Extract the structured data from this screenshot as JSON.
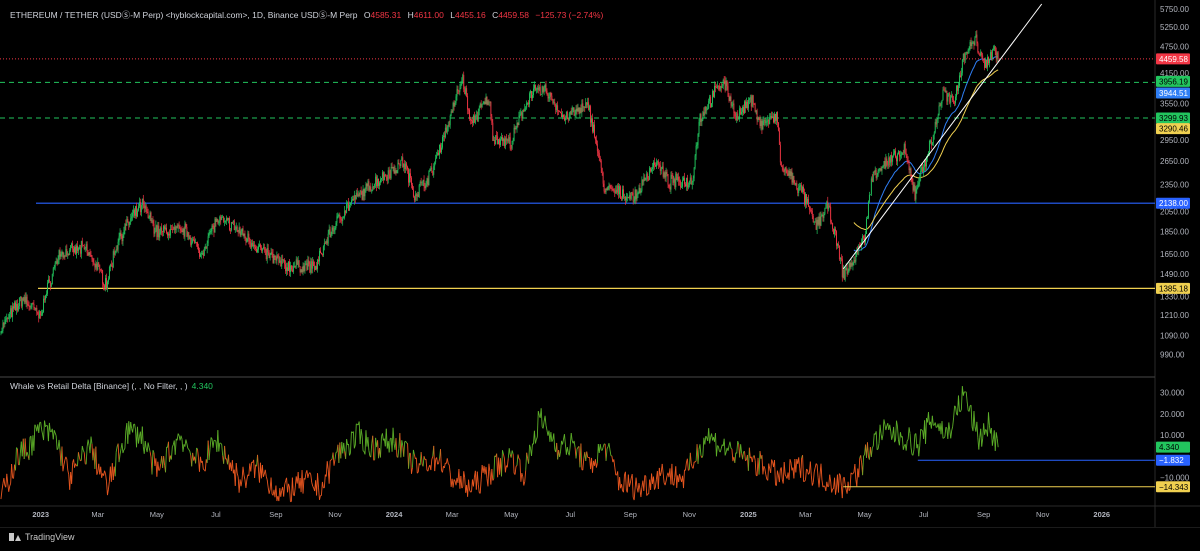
{
  "header": {
    "symbol": "ETHEREUM / TETHER (USDⓈ-M Perp) <hyblockcapital.com>, 1D, Binance USDⓈ-M Perp",
    "o_label": "O",
    "o_value": "4585.31",
    "h_label": "H",
    "h_value": "4611.00",
    "l_label": "L",
    "l_value": "4455.16",
    "c_label": "C",
    "c_value": "4459.58",
    "change": "−125.73 (−2.74%)"
  },
  "indicator": {
    "title": "Whale vs Retail Delta [Binance] (, , No Filter, , )",
    "value": "4.340"
  },
  "footer": {
    "brand": "TradingView"
  },
  "colors": {
    "background": "#000000",
    "up": "#22c55e",
    "down": "#f23645",
    "blue_level": "#2962ff",
    "yellow_level": "#f0d050",
    "green_dash": "#22c55e",
    "red_dotted": "#f23645",
    "trendline": "#ffffff",
    "ema_blue": "#2f7ff6",
    "ema_yellow": "#f0d050",
    "delta_pos": "#5cae28",
    "delta_neg": "#e8561f"
  },
  "chart_data": [
    {
      "type": "candlestick",
      "scale": "log",
      "ylim": [
        900,
        5900
      ],
      "xlim": [
        "2022-11-20",
        "2026-02-25"
      ],
      "price_ticks": [
        5750,
        5250,
        4750,
        4150,
        3950,
        3550,
        3250,
        2950,
        2650,
        2350,
        2050,
        1850,
        1650,
        1490,
        1330,
        1210,
        1090,
        990
      ],
      "time_labels": [
        {
          "date": "2023-01-01",
          "label": "2023"
        },
        {
          "date": "2023-03-01",
          "label": "Mar"
        },
        {
          "date": "2023-05-01",
          "label": "May"
        },
        {
          "date": "2023-07-01",
          "label": "Jul"
        },
        {
          "date": "2023-09-01",
          "label": "Sep"
        },
        {
          "date": "2023-11-01",
          "label": "Nov"
        },
        {
          "date": "2024-01-01",
          "label": "2024"
        },
        {
          "date": "2024-03-01",
          "label": "Mar"
        },
        {
          "date": "2024-05-01",
          "label": "May"
        },
        {
          "date": "2024-07-01",
          "label": "Jul"
        },
        {
          "date": "2024-09-01",
          "label": "Sep"
        },
        {
          "date": "2024-11-01",
          "label": "Nov"
        },
        {
          "date": "2025-01-01",
          "label": "2025"
        },
        {
          "date": "2025-03-01",
          "label": "Mar"
        },
        {
          "date": "2025-05-01",
          "label": "May"
        },
        {
          "date": "2025-07-01",
          "label": "Jul"
        },
        {
          "date": "2025-09-01",
          "label": "Sep"
        },
        {
          "date": "2025-11-01",
          "label": "Nov"
        },
        {
          "date": "2026-01-01",
          "label": "2026"
        }
      ],
      "close_anchors": [
        [
          "2022-11-21",
          1130
        ],
        [
          "2022-12-14",
          1320
        ],
        [
          "2022-12-31",
          1200
        ],
        [
          "2023-01-20",
          1650
        ],
        [
          "2023-02-16",
          1700
        ],
        [
          "2023-03-10",
          1420
        ],
        [
          "2023-03-23",
          1800
        ],
        [
          "2023-04-16",
          2120
        ],
        [
          "2023-05-01",
          1850
        ],
        [
          "2023-06-01",
          1860
        ],
        [
          "2023-06-15",
          1640
        ],
        [
          "2023-07-01",
          1950
        ],
        [
          "2023-07-15",
          1930
        ],
        [
          "2023-08-17",
          1680
        ],
        [
          "2023-09-11",
          1550
        ],
        [
          "2023-10-13",
          1550
        ],
        [
          "2023-10-24",
          1790
        ],
        [
          "2023-11-12",
          2080
        ],
        [
          "2023-12-09",
          2350
        ],
        [
          "2024-01-11",
          2640
        ],
        [
          "2024-01-22",
          2230
        ],
        [
          "2024-02-09",
          2500
        ],
        [
          "2024-02-27",
          3250
        ],
        [
          "2024-03-12",
          4050
        ],
        [
          "2024-03-20",
          3200
        ],
        [
          "2024-04-08",
          3650
        ],
        [
          "2024-04-12",
          3000
        ],
        [
          "2024-05-01",
          2900
        ],
        [
          "2024-05-21",
          3750
        ],
        [
          "2024-06-06",
          3800
        ],
        [
          "2024-06-24",
          3300
        ],
        [
          "2024-07-20",
          3500
        ],
        [
          "2024-08-05",
          2300
        ],
        [
          "2024-09-06",
          2200
        ],
        [
          "2024-09-27",
          2650
        ],
        [
          "2024-10-10",
          2380
        ],
        [
          "2024-11-04",
          2400
        ],
        [
          "2024-11-12",
          3300
        ],
        [
          "2024-12-06",
          4000
        ],
        [
          "2024-12-20",
          3300
        ],
        [
          "2025-01-06",
          3650
        ],
        [
          "2025-01-12",
          3200
        ],
        [
          "2025-01-31",
          3300
        ],
        [
          "2025-02-03",
          2600
        ],
        [
          "2025-02-26",
          2250
        ],
        [
          "2025-03-11",
          1900
        ],
        [
          "2025-03-24",
          2100
        ],
        [
          "2025-04-09",
          1480
        ],
        [
          "2025-04-20",
          1600
        ],
        [
          "2025-05-01",
          1800
        ],
        [
          "2025-05-10",
          2500
        ],
        [
          "2025-06-11",
          2780
        ],
        [
          "2025-06-22",
          2250
        ],
        [
          "2025-07-10",
          2950
        ],
        [
          "2025-07-21",
          3750
        ],
        [
          "2025-08-01",
          3550
        ],
        [
          "2025-08-13",
          4650
        ],
        [
          "2025-08-24",
          4900
        ],
        [
          "2025-09-01",
          4350
        ],
        [
          "2025-09-13",
          4700
        ],
        [
          "2025-09-16",
          4460
        ]
      ],
      "levels": [
        {
          "name": "last-price",
          "value": 4459.58,
          "label": "4459.58",
          "style": "dotted",
          "color": "#f23645",
          "tag_bg": "#f23645",
          "tag_fg": "#ffffff"
        },
        {
          "name": "green-resistance",
          "value": 3956.19,
          "label": "3956.19",
          "style": "dashed",
          "color": "#22c55e",
          "tag_bg": "#22c55e",
          "tag_fg": "#000000"
        },
        {
          "name": "green-mid",
          "value": 3299.93,
          "label": "3299.93",
          "style": "dashed",
          "color": "#22c55e",
          "tag_bg": "#22c55e",
          "tag_fg": "#000000"
        },
        {
          "name": "blue-support",
          "value": 2138.0,
          "label": "2138.00",
          "style": "solid",
          "color": "#2962ff",
          "tag_bg": "#2962ff",
          "tag_fg": "#ffffff"
        },
        {
          "name": "yellow-support",
          "value": 1385.18,
          "label": "1385.18",
          "style": "solid",
          "color": "#f0d050",
          "tag_bg": "#f0d050",
          "tag_fg": "#000000"
        }
      ],
      "ema_tags": [
        {
          "name": "ema-blue",
          "label": "3944.51",
          "value": 3944.51,
          "bg": "#2f7ff6",
          "fg": "#ffffff"
        },
        {
          "name": "ema-yellow",
          "label": "3290.46",
          "value": 3290.46,
          "bg": "#f0d050",
          "fg": "#000000"
        }
      ],
      "trendline": {
        "from": [
          "2025-04-09",
          1530
        ],
        "to": [
          "2025-10-31",
          5900
        ]
      }
    },
    {
      "type": "line",
      "name": "Whale vs Retail Delta",
      "ylim": [
        -22,
        36
      ],
      "y_ticks": [
        30,
        20,
        10,
        -10
      ],
      "y_tick_labels": [
        "30.000",
        "20.000",
        "10.000",
        "−10.000"
      ],
      "anchors": [
        [
          "2022-11-21",
          -20
        ],
        [
          "2022-12-08",
          0
        ],
        [
          "2022-12-21",
          5
        ],
        [
          "2022-12-29",
          12
        ],
        [
          "2023-01-15",
          10
        ],
        [
          "2023-01-31",
          -10
        ],
        [
          "2023-02-21",
          5
        ],
        [
          "2023-03-11",
          -15
        ],
        [
          "2023-03-31",
          12
        ],
        [
          "2023-04-15",
          10
        ],
        [
          "2023-05-01",
          -8
        ],
        [
          "2023-05-25",
          10
        ],
        [
          "2023-06-15",
          -5
        ],
        [
          "2023-07-02",
          8
        ],
        [
          "2023-07-26",
          -12
        ],
        [
          "2023-08-12",
          -5
        ],
        [
          "2023-09-06",
          -18
        ],
        [
          "2023-10-02",
          -12
        ],
        [
          "2023-10-18",
          -15
        ],
        [
          "2023-11-01",
          0
        ],
        [
          "2023-11-26",
          10
        ],
        [
          "2023-12-09",
          4
        ],
        [
          "2024-01-01",
          8
        ],
        [
          "2024-01-24",
          -5
        ],
        [
          "2024-02-16",
          0
        ],
        [
          "2024-03-01",
          -10
        ],
        [
          "2024-03-20",
          -15
        ],
        [
          "2024-04-15",
          -5
        ],
        [
          "2024-05-01",
          0
        ],
        [
          "2024-05-15",
          -8
        ],
        [
          "2024-05-30",
          18
        ],
        [
          "2024-06-18",
          5
        ],
        [
          "2024-07-04",
          5
        ],
        [
          "2024-07-20",
          -5
        ],
        [
          "2024-08-06",
          5
        ],
        [
          "2024-08-21",
          -12
        ],
        [
          "2024-09-11",
          -15
        ],
        [
          "2024-10-03",
          -8
        ],
        [
          "2024-10-27",
          -10
        ],
        [
          "2024-11-19",
          10
        ],
        [
          "2024-12-03",
          5
        ],
        [
          "2024-12-25",
          0
        ],
        [
          "2025-01-18",
          -5
        ],
        [
          "2025-02-03",
          -10
        ],
        [
          "2025-02-25",
          -5
        ],
        [
          "2025-03-20",
          -10
        ],
        [
          "2025-04-09",
          -14
        ],
        [
          "2025-04-23",
          -8
        ],
        [
          "2025-05-08",
          5
        ],
        [
          "2025-05-23",
          12
        ],
        [
          "2025-06-07",
          10
        ],
        [
          "2025-06-25",
          5
        ],
        [
          "2025-07-10",
          18
        ],
        [
          "2025-07-25",
          10
        ],
        [
          "2025-08-12",
          30
        ],
        [
          "2025-08-27",
          8
        ],
        [
          "2025-09-06",
          15
        ],
        [
          "2025-09-16",
          4.34
        ]
      ],
      "levels": [
        {
          "name": "delta-current",
          "value": 4.34,
          "label": "4.340",
          "bg": "#22c55e",
          "fg": "#000000",
          "line": false
        },
        {
          "name": "delta-blue",
          "value": -1.832,
          "label": "−1.832",
          "bg": "#2962ff",
          "fg": "#ffffff",
          "line": true,
          "from": "2025-06-25",
          "color": "#2962ff"
        },
        {
          "name": "delta-yellow",
          "value": -14.343,
          "label": "−14.343",
          "bg": "#f0d050",
          "fg": "#000000",
          "line": true,
          "from": "2025-04-09",
          "color": "#f0d050"
        }
      ]
    }
  ]
}
